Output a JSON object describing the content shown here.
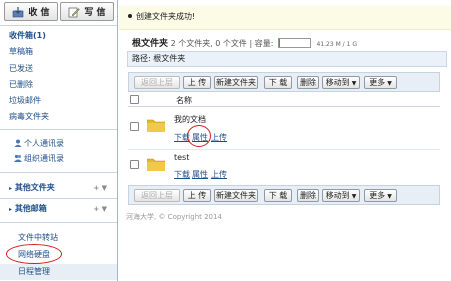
{
  "sidebar": {
    "inbox_button": "收 信",
    "compose_button": "写 信",
    "items": [
      {
        "label": "收件箱(1)",
        "bold": true
      },
      {
        "label": "草稿箱"
      },
      {
        "label": "已发送"
      },
      {
        "label": "已删除"
      },
      {
        "label": "垃圾邮件"
      },
      {
        "label": "病毒文件夹"
      }
    ],
    "contacts": [
      {
        "label": "个人通讯录"
      },
      {
        "label": "组织通讯录"
      }
    ],
    "other_folders": {
      "label": "其他文件夹",
      "actions": "+ ▼"
    },
    "other_mailboxes": {
      "label": "其他邮箱",
      "actions": "+ ▼"
    },
    "transfer": "文件中转站",
    "netdisk": "网络硬盘",
    "calendar": "日程管理"
  },
  "notice": "创建文件夹成功!",
  "header": {
    "title": "根文件夹",
    "summary": "2 个文件夹, 0 个文件",
    "separator": "|",
    "capacity_label": "容量:",
    "capacity_text": "41.23 M / 1 G",
    "usage_fraction": 0.04
  },
  "path": "路径: 根文件夹",
  "toolbar": {
    "back": "返回上层",
    "upload": "上 传",
    "new_folder": "新建文件夹",
    "download": "下 载",
    "delete": "删除",
    "move_to": "移动到",
    "more": "更多"
  },
  "list": {
    "column_name": "名称",
    "rows": [
      {
        "name": "我的文档",
        "actions": [
          "下载",
          "属性",
          "上传"
        ]
      },
      {
        "name": "test",
        "actions": [
          "下载",
          "属性",
          "上传"
        ]
      }
    ]
  },
  "footer": "河海大学, © Copyright 2014",
  "colors": {
    "link": "#1f4e8c",
    "folder": "#e8b830",
    "annotation": "#d02020",
    "usage_bar": "#2aa83a"
  }
}
